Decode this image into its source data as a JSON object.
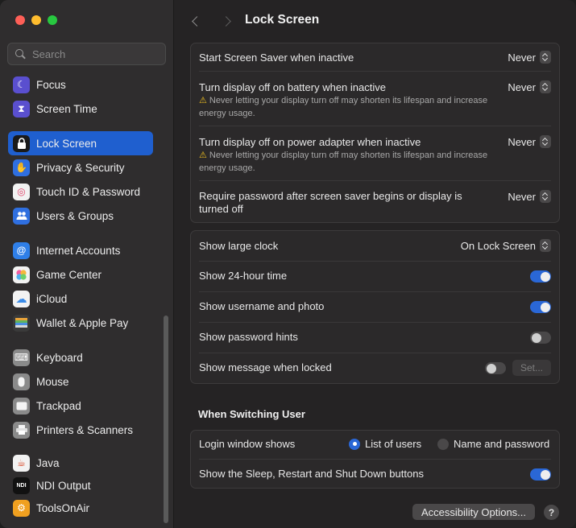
{
  "sidebar": {
    "search_placeholder": "Search",
    "items": [
      {
        "label": "Focus",
        "icon": "moon-icon",
        "color": "#5a4fcf",
        "glyph": "☾"
      },
      {
        "label": "Screen Time",
        "icon": "hourglass-icon",
        "color": "#5a4fcf",
        "glyph": "⧗"
      },
      {
        "label": "Lock Screen",
        "icon": "lock-icon",
        "color": "#1a1a1a",
        "glyph": "🔒"
      },
      {
        "label": "Privacy & Security",
        "icon": "hand-icon",
        "color": "#2f6fe0",
        "glyph": "✋"
      },
      {
        "label": "Touch ID & Password",
        "icon": "fingerprint-icon",
        "color": "#f2f2f2",
        "glyph": "◎"
      },
      {
        "label": "Users & Groups",
        "icon": "users-icon",
        "color": "#2f6fe0",
        "glyph": "👥"
      },
      {
        "label": "Internet Accounts",
        "icon": "at-icon",
        "color": "#2f7fe8",
        "glyph": "@"
      },
      {
        "label": "Game Center",
        "icon": "game-center-icon",
        "color": "#f2f2f2",
        "glyph": "●"
      },
      {
        "label": "iCloud",
        "icon": "cloud-icon",
        "color": "#f2f2f2",
        "glyph": "☁"
      },
      {
        "label": "Wallet & Apple Pay",
        "icon": "wallet-icon",
        "color": "#3a3a3a",
        "glyph": "▤"
      },
      {
        "label": "Keyboard",
        "icon": "keyboard-icon",
        "color": "#8a8a8a",
        "glyph": "⌨"
      },
      {
        "label": "Mouse",
        "icon": "mouse-icon",
        "color": "#8a8a8a",
        "glyph": "▮"
      },
      {
        "label": "Trackpad",
        "icon": "trackpad-icon",
        "color": "#8a8a8a",
        "glyph": "▭"
      },
      {
        "label": "Printers & Scanners",
        "icon": "printer-icon",
        "color": "#8a8a8a",
        "glyph": "⎙"
      },
      {
        "label": "Java",
        "icon": "java-icon",
        "color": "#f2f2f2",
        "glyph": "☕"
      },
      {
        "label": "NDI Output",
        "icon": "ndi-icon",
        "color": "#111111",
        "glyph": "NDI"
      },
      {
        "label": "ToolsOnAir",
        "icon": "toolsonair-icon",
        "color": "#f0a020",
        "glyph": "⚙"
      }
    ]
  },
  "header": {
    "title": "Lock Screen"
  },
  "group1": {
    "screen_saver_label": "Start Screen Saver when inactive",
    "screen_saver_value": "Never",
    "battery_label": "Turn display off on battery when inactive",
    "battery_value": "Never",
    "battery_warning": "Never letting your display turn off may shorten its lifespan and increase energy usage.",
    "adapter_label": "Turn display off on power adapter when inactive",
    "adapter_value": "Never",
    "adapter_warning": "Never letting your display turn off may shorten its lifespan and increase energy usage.",
    "require_pw_label": "Require password after screen saver begins or display is turned off",
    "require_pw_value": "Never"
  },
  "group2": {
    "large_clock_label": "Show large clock",
    "large_clock_value": "On Lock Screen",
    "hour24_label": "Show 24-hour time",
    "username_label": "Show username and photo",
    "hints_label": "Show password hints",
    "message_label": "Show message when locked",
    "set_label": "Set..."
  },
  "switching": {
    "section_title": "When Switching User",
    "login_label": "Login window shows",
    "option_list": "List of users",
    "option_name": "Name and password",
    "sleep_label": "Show the Sleep, Restart and Shut Down buttons"
  },
  "footer": {
    "accessibility_label": "Accessibility Options...",
    "help_label": "?"
  }
}
